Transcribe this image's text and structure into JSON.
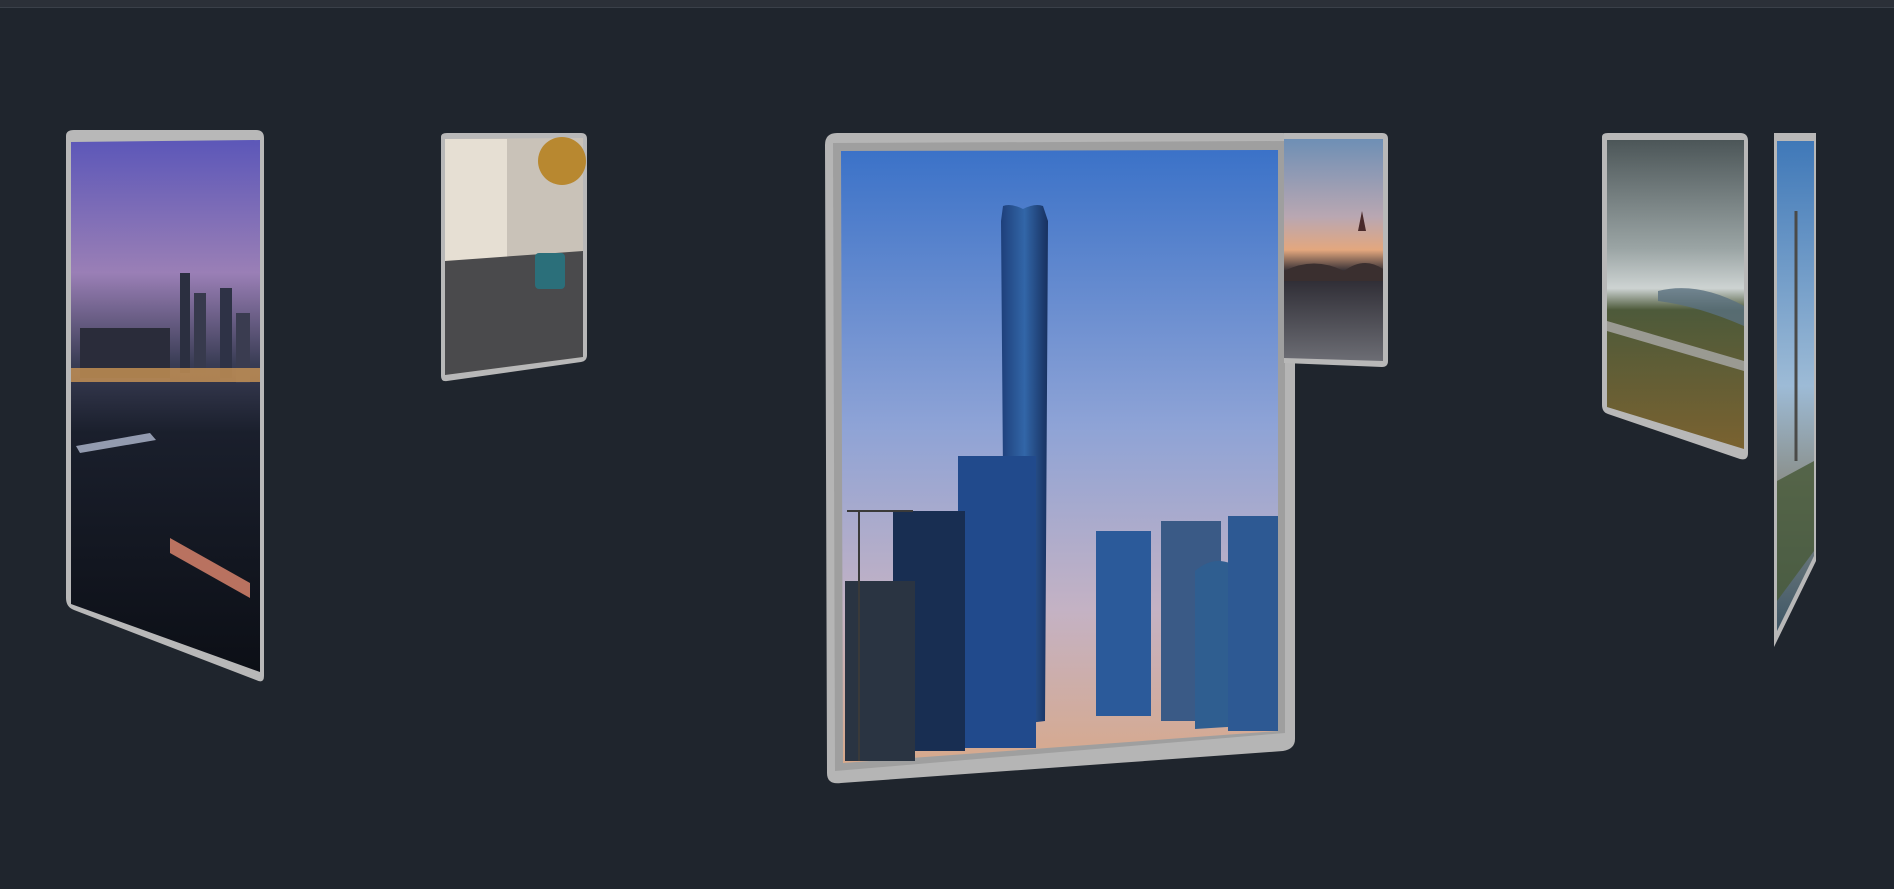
{
  "gallery": {
    "cards": [
      {
        "id": "harbor-night",
        "subject": "city-harbor-night-photo",
        "active": false
      },
      {
        "id": "tram-street",
        "subject": "tram-street-photo",
        "active": false
      },
      {
        "id": "skyscraper-skyline",
        "subject": "skyscraper-skyline-photo",
        "active": true
      },
      {
        "id": "bridge-sunset",
        "subject": "bridge-sunset-photo",
        "active": false
      },
      {
        "id": "coastal-road",
        "subject": "coastal-road-photo",
        "active": false
      },
      {
        "id": "spire-tower",
        "subject": "spire-tower-photo",
        "active": false
      }
    ]
  },
  "colors": {
    "background": "#1f252d",
    "frame": "#b7b7b7",
    "frame_dark": "#8c8c8c"
  }
}
